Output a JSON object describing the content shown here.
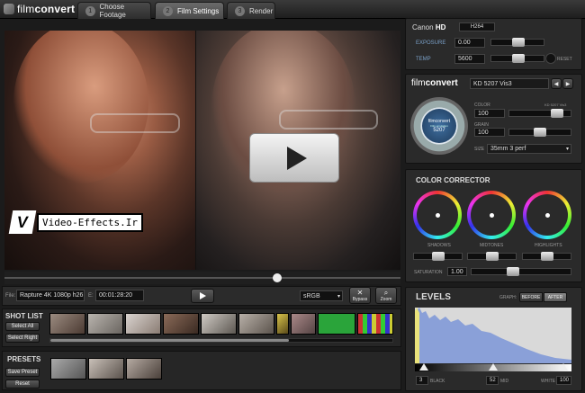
{
  "header": {
    "logo": {
      "light": "film",
      "bold": "convert"
    },
    "tabs": [
      {
        "num": "1",
        "label": "Choose Footage"
      },
      {
        "num": "2",
        "label": "Film Settings"
      },
      {
        "num": "3",
        "label": "Render"
      }
    ]
  },
  "viewer": {
    "watermark_letter": "V",
    "watermark_text": "Video-Effects.Ir"
  },
  "playbar": {
    "file_label": "File:",
    "file_value": "Rapture 4K 1080p h26",
    "e_label": "E:",
    "timecode": "00:01:28:20",
    "colorspace": "sRGB",
    "bypass_label": "Bypass",
    "zoom_label": "Zoom"
  },
  "shot_list": {
    "title": "SHOT LIST",
    "select_all": "Select All",
    "select_right": "Select Right"
  },
  "presets": {
    "title": "PRESETS",
    "save": "Save Preset",
    "reset": "Reset"
  },
  "camera": {
    "brand": "Canon",
    "model": "HD",
    "format": "H264",
    "exposure_label": "EXPOSURE",
    "exposure_value": "0.00",
    "temp_label": "TEMP",
    "temp_value": "5600",
    "reset_label": "RESET"
  },
  "film": {
    "logo_light": "film",
    "logo_bold": "convert",
    "stock": "KD 5207 Vis3",
    "color_label": "COLOR",
    "color_value": "100",
    "color_right": "KD 5207 Vis3",
    "grain_label": "GRAIN",
    "grain_value": "100",
    "size_label": "SIZE",
    "size_value": "35mm 3 perf",
    "canister_brand": "filmconvert",
    "canister_sub": "Film emulation",
    "canister_num": "5207"
  },
  "color_corrector": {
    "title": "COLOR CORRECTOR",
    "wheels": [
      "SHADOWS",
      "MIDTONES",
      "HIGHLIGHTS"
    ],
    "saturation_label": "SATURATION",
    "saturation_value": "1.00"
  },
  "levels": {
    "title": "LEVELS",
    "graph_label": "GRAPH:",
    "before": "BEFORE",
    "after": "AFTER",
    "black_value": "3",
    "black_label": "BLACK",
    "mid_value": "52",
    "mid_label": "MID",
    "white_label": "WHITE",
    "white_value": "100"
  },
  "colors": {
    "accent": "#e6e6e6",
    "histogram_yellow": "#e9e27a",
    "histogram_blue": "#8aa0d8"
  }
}
